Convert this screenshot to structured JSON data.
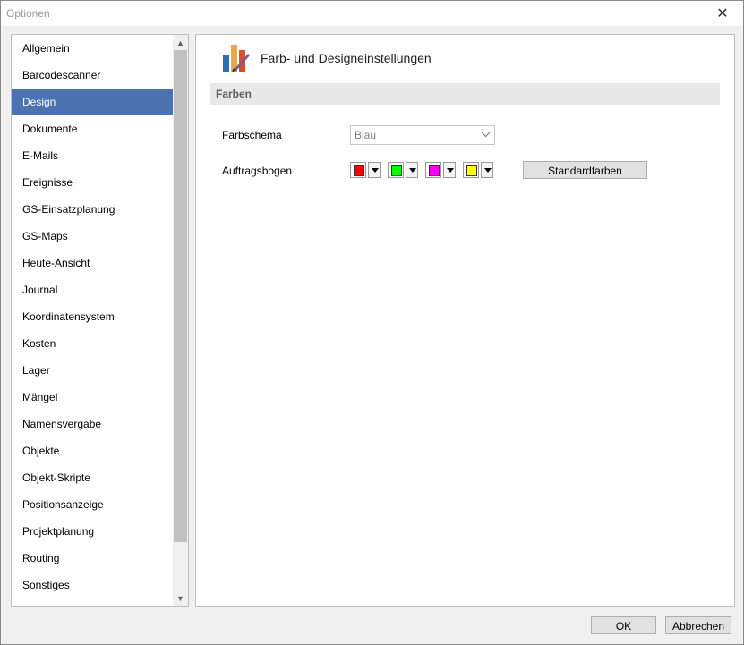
{
  "window": {
    "title": "Optionen",
    "close_glyph": "✕"
  },
  "sidebar": {
    "selected_index": 2,
    "items": [
      {
        "label": "Allgemein"
      },
      {
        "label": "Barcodescanner"
      },
      {
        "label": "Design"
      },
      {
        "label": "Dokumente"
      },
      {
        "label": "E-Mails"
      },
      {
        "label": "Ereignisse"
      },
      {
        "label": "GS-Einsatzplanung"
      },
      {
        "label": "GS-Maps"
      },
      {
        "label": "Heute-Ansicht"
      },
      {
        "label": "Journal"
      },
      {
        "label": "Koordinatensystem"
      },
      {
        "label": "Kosten"
      },
      {
        "label": "Lager"
      },
      {
        "label": "Mängel"
      },
      {
        "label": "Namensvergabe"
      },
      {
        "label": "Objekte"
      },
      {
        "label": "Objekt-Skripte"
      },
      {
        "label": "Positionsanzeige"
      },
      {
        "label": "Projektplanung"
      },
      {
        "label": "Routing"
      },
      {
        "label": "Sonstiges"
      }
    ],
    "scroll_up_glyph": "▲",
    "scroll_down_glyph": "▼"
  },
  "panel": {
    "title": "Farb- und Designeinstellungen",
    "icon": "design-palette-icon",
    "section_label": "Farben",
    "farbschema_label": "Farbschema",
    "farbschema_value": "Blau",
    "auftragsbogen_label": "Auftragsbogen",
    "colors": [
      {
        "name": "red",
        "hex": "#ff0000"
      },
      {
        "name": "green",
        "hex": "#00ff00"
      },
      {
        "name": "magenta",
        "hex": "#ff00ff"
      },
      {
        "name": "yellow",
        "hex": "#ffff00"
      }
    ],
    "standard_button": "Standardfarben"
  },
  "footer": {
    "ok_label": "OK",
    "cancel_label": "Abbrechen"
  }
}
